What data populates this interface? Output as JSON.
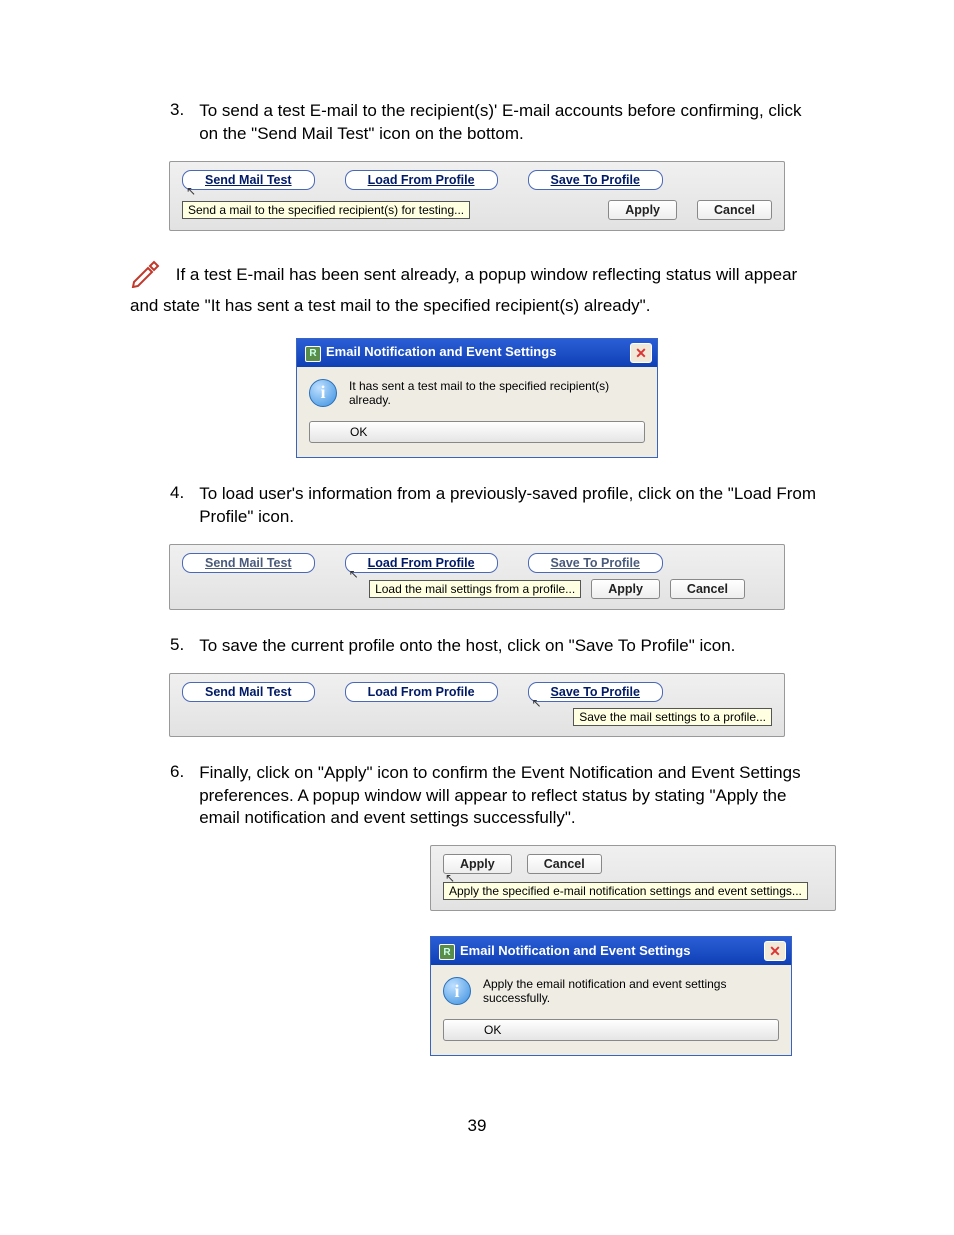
{
  "step3": {
    "num": "3.",
    "text": "To send a test E-mail to the recipient(s)' E-mail accounts before confirming, click on the \"Send Mail Test\" icon on the bottom."
  },
  "panel1": {
    "sendMailTest": "Send Mail Test",
    "loadFromProfile": "Load From Profile",
    "saveToProfile": "Save To Profile",
    "tooltip": "Send a mail to the specified recipient(s) for testing...",
    "apply": "Apply",
    "cancel": "Cancel"
  },
  "noteText": "If a test E-mail has been sent already, a popup window reflecting status will appear and state \"It has sent a test mail to the specified recipient(s) already\".",
  "dialog1": {
    "title": "Email Notification and Event Settings",
    "msg": "It has sent a test mail to the specified recipient(s) already.",
    "ok": "OK"
  },
  "step4": {
    "num": "4.",
    "text": "To load user's information from a previously-saved profile, click on the \"Load From Profile\" icon."
  },
  "panel2": {
    "sendMailTest": "Send Mail Test",
    "loadFromProfile": "Load From Profile",
    "saveToProfile": "Save To Profile",
    "tooltip": "Load the mail settings from a profile...",
    "apply": "Apply",
    "cancel": "Cancel"
  },
  "step5": {
    "num": "5.",
    "text": "To save the current profile onto the host, click on \"Save To Profile\" icon."
  },
  "panel3": {
    "sendMailTest": "Send Mail Test",
    "loadFromProfile": "Load From Profile",
    "saveToProfile": "Save To Profile",
    "tooltip": "Save the mail settings to a profile..."
  },
  "step6": {
    "num": "6.",
    "text": "Finally, click on \"Apply\" icon to confirm the Event Notification and Event Settings preferences.   A popup window will appear to reflect status by stating \"Apply the email notification and event settings successfully\"."
  },
  "panel4": {
    "apply": "Apply",
    "cancel": "Cancel",
    "tooltip": "Apply the specified e-mail notification settings and event settings..."
  },
  "dialog2": {
    "title": "Email Notification and Event Settings",
    "msg": "Apply the email notification and event settings successfully.",
    "ok": "OK"
  },
  "pageNum": "39"
}
